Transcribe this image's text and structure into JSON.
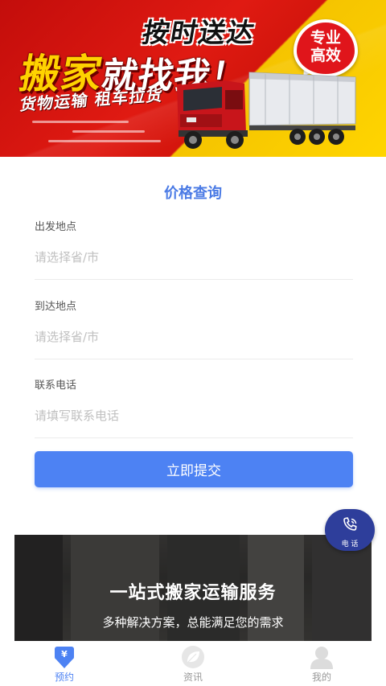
{
  "banner": {
    "line_top": "按时送达",
    "line_main_a": "搬家",
    "line_main_b": "就找我！",
    "line_sub": "货物运输 租车拉货",
    "badge_line1": "专业",
    "badge_line2": "高效"
  },
  "form": {
    "title": "价格查询",
    "fields": [
      {
        "label": "出发地点",
        "placeholder": "请选择省/市",
        "value": ""
      },
      {
        "label": "到达地点",
        "placeholder": "请选择省/市",
        "value": ""
      },
      {
        "label": "联系电话",
        "placeholder": "请填写联系电话",
        "value": ""
      }
    ],
    "submit_label": "立即提交"
  },
  "promo": {
    "title": "一站式搬家运输服务",
    "subtitle": "多种解决方案，总能满足您的需求"
  },
  "phone_fab": {
    "label": "电 话",
    "icon": "phone-icon"
  },
  "tabbar": {
    "tabs": [
      {
        "label": "预约",
        "icon": "calendar-download-icon",
        "active": true
      },
      {
        "label": "资讯",
        "icon": "leaf-icon",
        "active": false
      },
      {
        "label": "我的",
        "icon": "user-icon",
        "active": false
      }
    ]
  },
  "colors": {
    "accent": "#4d82f3",
    "title_blue": "#4b7be5",
    "fab": "#2e3e9b",
    "banner_red": "#d4160d",
    "banner_yellow": "#ffd500"
  }
}
